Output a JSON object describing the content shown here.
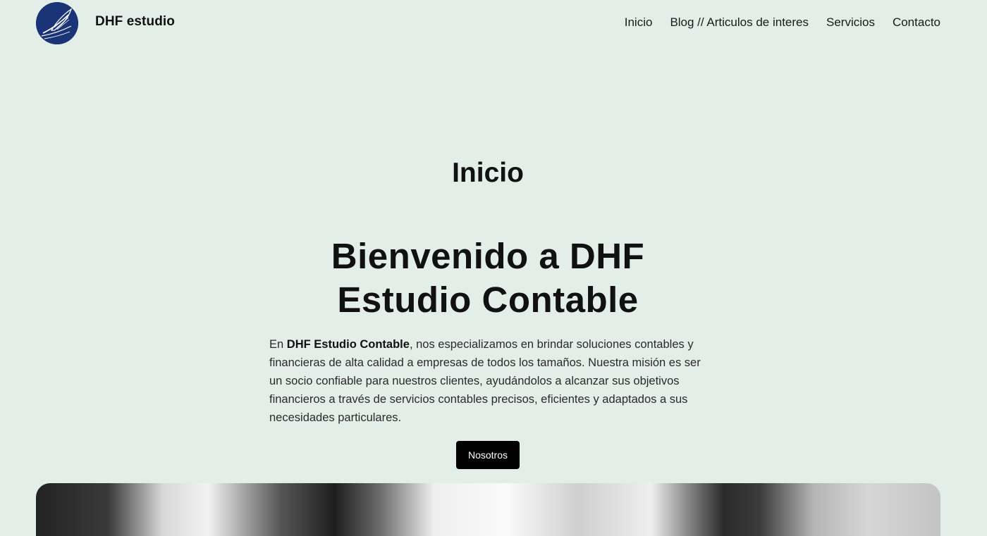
{
  "header": {
    "site_title": "DHF estudio",
    "logo_icon": "quill-pen-logo-icon",
    "nav": [
      {
        "label": "Inicio"
      },
      {
        "label": "Blog // Articulos de interes"
      },
      {
        "label": "Servicios"
      },
      {
        "label": "Contacto"
      }
    ]
  },
  "main": {
    "page_heading": "Inicio",
    "hero_title": "Bienvenido a DHF Estudio Contable",
    "intro": {
      "prefix": "En ",
      "brand": "DHF Estudio Contable",
      "rest": ", nos especializamos en brindar soluciones contables y financieras de alta calidad a empresas de todos los tamaños. Nuestra misión es ser un socio confiable para nuestros clientes, ayudándolos a alcanzar sus objetivos financieros a través de servicios contables precisos, eficientes y adaptados a sus necesidades particulares."
    },
    "cta_label": "Nosotros"
  },
  "colors": {
    "background": "#e3eee9",
    "logo": "#1b3478",
    "button": "#000000"
  }
}
